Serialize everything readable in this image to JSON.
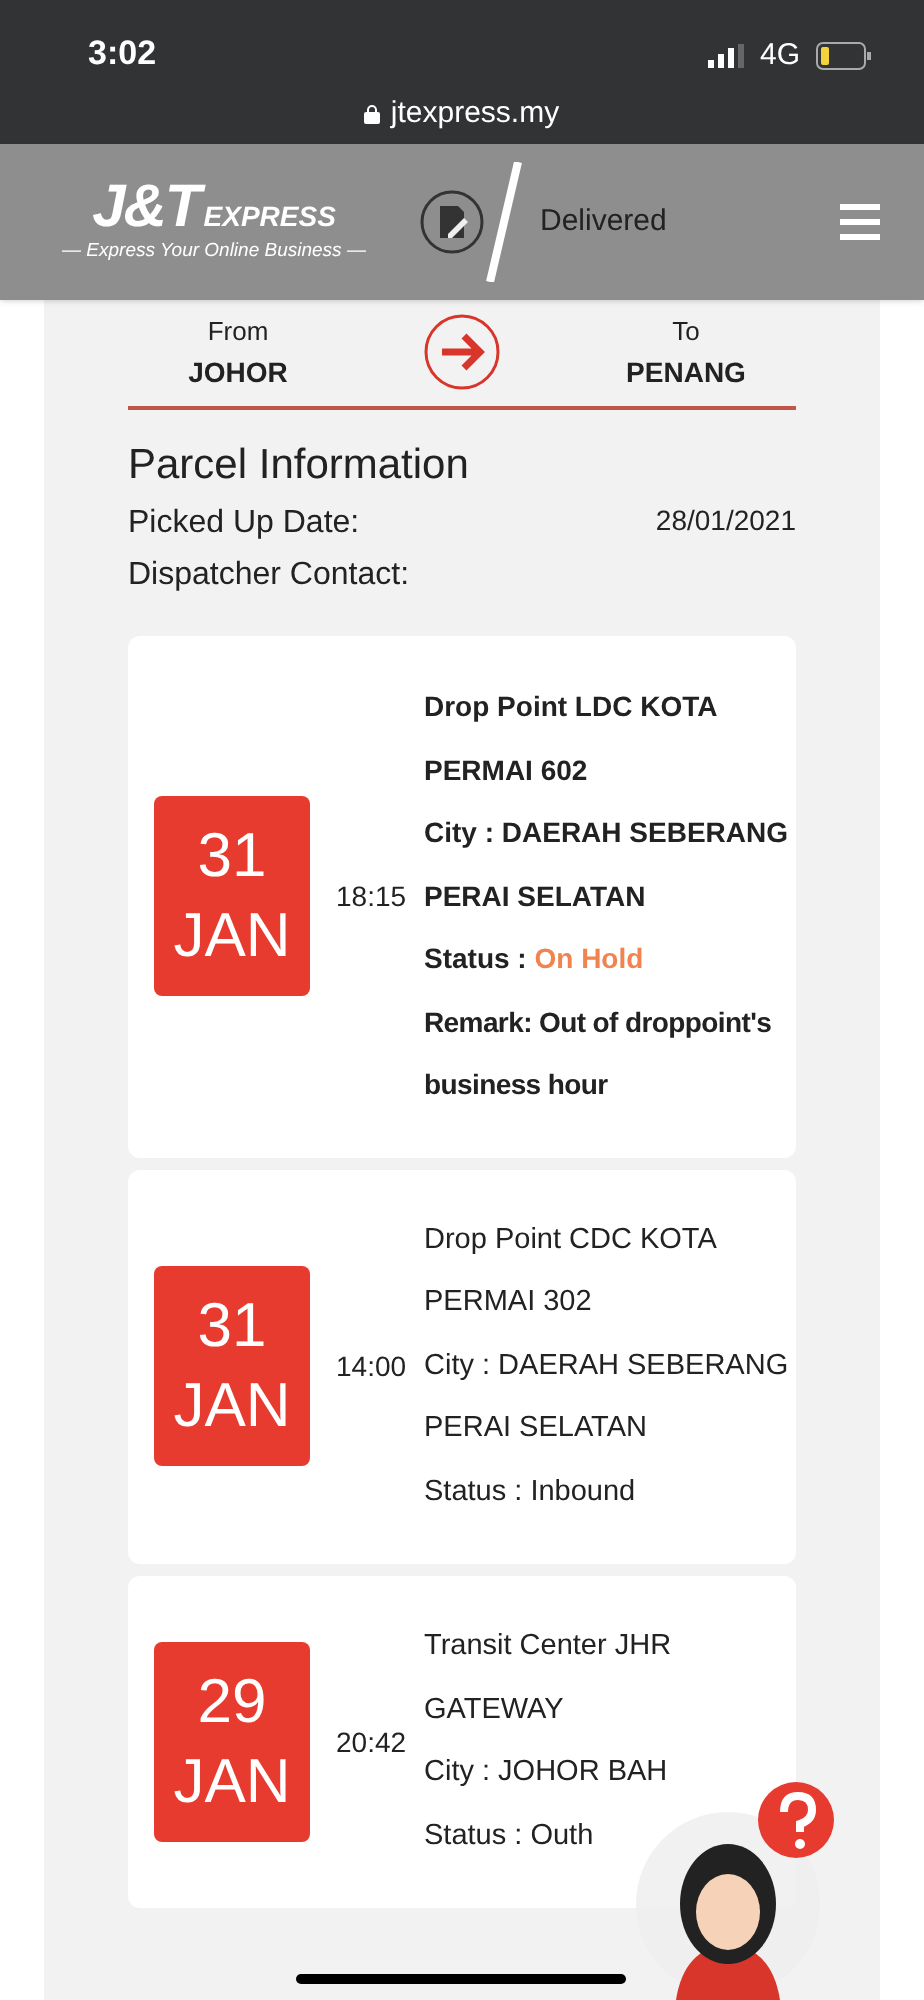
{
  "status_bar": {
    "time": "3:02",
    "network": "4G",
    "url": "jtexpress.my"
  },
  "header": {
    "logo": "J&T",
    "logo_word": "EXPRESS",
    "tagline": "— Express Your Online Business —",
    "step_label": "Delivered"
  },
  "route": {
    "from_label": "From",
    "from": "JOHOR",
    "to_label": "To",
    "to": "PENANG"
  },
  "parcel": {
    "title": "Parcel Information",
    "picked_up_label": "Picked Up Date:",
    "picked_up_value": "28/01/2021",
    "dispatcher_label": "Dispatcher Contact:"
  },
  "events": [
    {
      "day": "31",
      "month": "JAN",
      "time": "18:15",
      "highlighted": true,
      "place": "Drop Point LDC KOTA PERMAI 602",
      "city": "City : DAERAH SEBERANG PERAI SELATAN",
      "status_label": "Status :",
      "status": "On Hold",
      "remark": "Remark: Out of droppoint's business hour"
    },
    {
      "day": "31",
      "month": "JAN",
      "time": "14:00",
      "highlighted": false,
      "place": "Drop Point CDC KOTA PERMAI 302",
      "city": "City : DAERAH SEBERANG PERAI SELATAN",
      "status_label": "Status :",
      "status": "Inbound"
    },
    {
      "day": "29",
      "month": "JAN",
      "time": "20:42",
      "highlighted": false,
      "place": "Transit Center JHR GATEWAY",
      "city": "City : JOHOR BAH",
      "status_label": "Status :",
      "status": "Outh"
    }
  ]
}
